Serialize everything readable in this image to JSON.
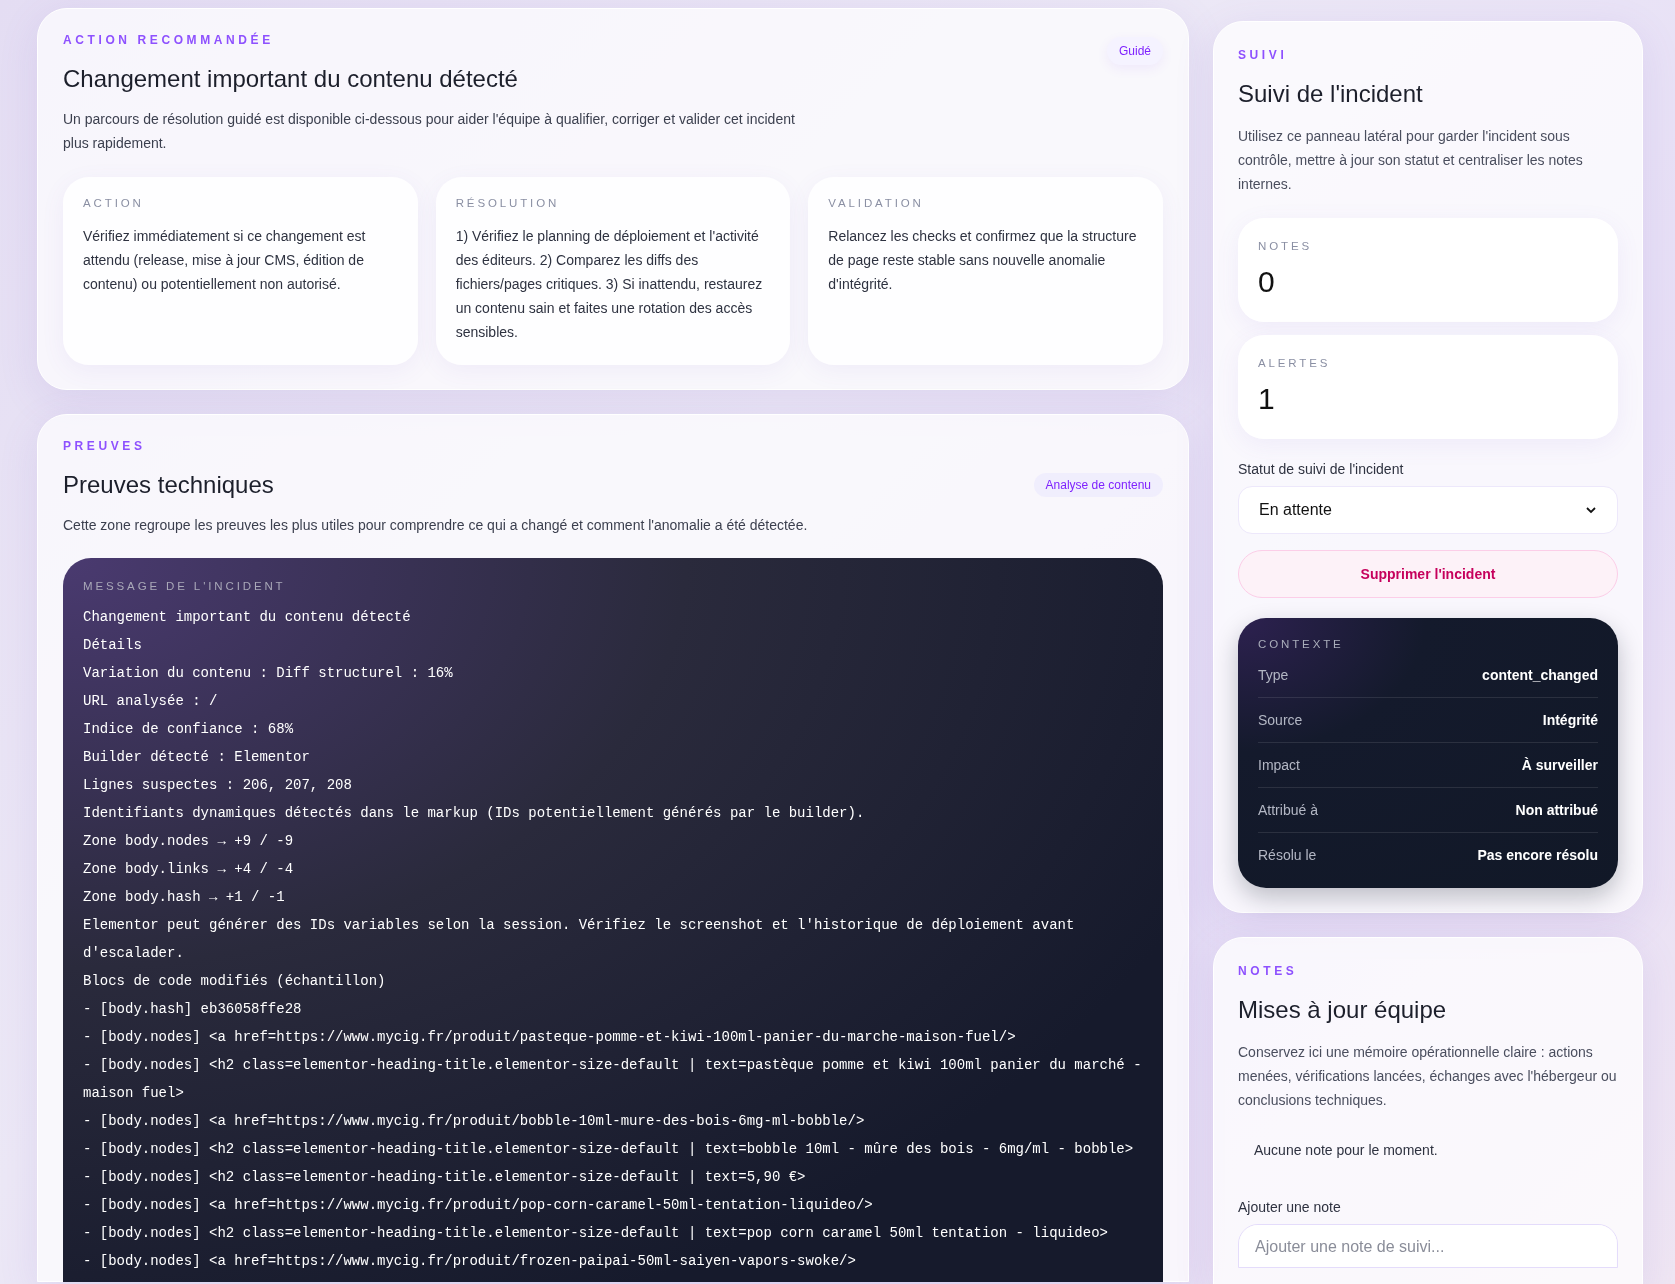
{
  "recommended": {
    "eyebrow": "ACTION RECOMMANDÉE",
    "title": "Changement important du contenu détecté",
    "badge": "Guidé",
    "description": "Un parcours de résolution guidé est disponible ci-dessous pour aider l'équipe à qualifier, corriger et valider cet incident plus rapidement.",
    "steps": [
      {
        "label": "ACTION",
        "text": "Vérifiez immédiatement si ce changement est attendu (release, mise à jour CMS, édition de contenu) ou potentiellement non autorisé."
      },
      {
        "label": "RÉSOLUTION",
        "text": "1) Vérifiez le planning de déploiement et l'activité des éditeurs. 2) Comparez les diffs des fichiers/pages critiques. 3) Si inattendu, restaurez un contenu sain et faites une rotation des accès sensibles."
      },
      {
        "label": "VALIDATION",
        "text": "Relancez les checks et confirmez que la structure de page reste stable sans nouvelle anomalie d'intégrité."
      }
    ]
  },
  "evidence": {
    "eyebrow": "PREUVES",
    "title": "Preuves techniques",
    "badge": "Analyse de contenu",
    "description": "Cette zone regroupe les preuves les plus utiles pour comprendre ce qui a changé et comment l'anomalie a été détectée.",
    "message": {
      "label": "MESSAGE DE L'INCIDENT",
      "lines": [
        "Changement important du contenu détecté",
        "Détails",
        "Variation du contenu : Diff structurel : 16%",
        "URL analysée : /",
        "Indice de confiance : 68%",
        "Builder détecté : Elementor",
        "Lignes suspectes : 206, 207, 208",
        "Identifiants dynamiques détectés dans le markup (IDs potentiellement générés par le builder).",
        "Zone body.nodes → +9 / -9",
        "Zone body.links → +4 / -4",
        "Zone body.hash → +1 / -1",
        "Elementor peut générer des IDs variables selon la session. Vérifiez le screenshot et l'historique de déploiement avant d'escalader.",
        "Blocs de code modifiés (échantillon)",
        "- [body.hash] eb36058ffe28",
        "- [body.nodes] <a href=https://www.mycig.fr/produit/pasteque-pomme-et-kiwi-100ml-panier-du-marche-maison-fuel/>",
        "- [body.nodes] <h2 class=elementor-heading-title.elementor-size-default | text=pastèque pomme et kiwi 100ml panier du marché - maison fuel>",
        "- [body.nodes] <a href=https://www.mycig.fr/produit/bobble-10ml-mure-des-bois-6mg-ml-bobble/>",
        "- [body.nodes] <h2 class=elementor-heading-title.elementor-size-default | text=bobble 10ml - mûre des bois - 6mg/ml - bobble>",
        "- [body.nodes] <h2 class=elementor-heading-title.elementor-size-default | text=5,90 €>",
        "- [body.nodes] <a href=https://www.mycig.fr/produit/pop-corn-caramel-50ml-tentation-liquideo/>",
        "- [body.nodes] <h2 class=elementor-heading-title.elementor-size-default | text=pop corn caramel 50ml tentation - liquideo>",
        "- [body.nodes] <a href=https://www.mycig.fr/produit/frozen-paipai-50ml-saiyen-vapors-swoke/>"
      ]
    }
  },
  "tracking": {
    "eyebrow": "SUIVI",
    "title": "Suivi de l'incident",
    "description": "Utilisez ce panneau latéral pour garder l'incident sous contrôle, mettre à jour son statut et centraliser les notes internes.",
    "stats": [
      {
        "label": "NOTES",
        "value": "0"
      },
      {
        "label": "ALERTES",
        "value": "1"
      }
    ],
    "status_field": {
      "label": "Statut de suivi de l'incident",
      "value": "En attente"
    },
    "delete_button": "Supprimer l'incident",
    "context": {
      "label": "CONTEXTE",
      "rows": [
        {
          "label": "Type",
          "value": "content_changed"
        },
        {
          "label": "Source",
          "value": "Intégrité"
        },
        {
          "label": "Impact",
          "value": "À surveiller"
        },
        {
          "label": "Attribué à",
          "value": "Non attribué"
        },
        {
          "label": "Résolu le",
          "value": "Pas encore résolu"
        }
      ]
    }
  },
  "notes": {
    "eyebrow": "NOTES",
    "title": "Mises à jour équipe",
    "description": "Conservez ici une mémoire opérationnelle claire : actions menées, vérifications lancées, échanges avec l'hébergeur ou conclusions techniques.",
    "empty_text": "Aucune note pour le moment.",
    "add_note": {
      "label": "Ajouter une note",
      "placeholder": "Ajouter une note de suivi..."
    }
  }
}
